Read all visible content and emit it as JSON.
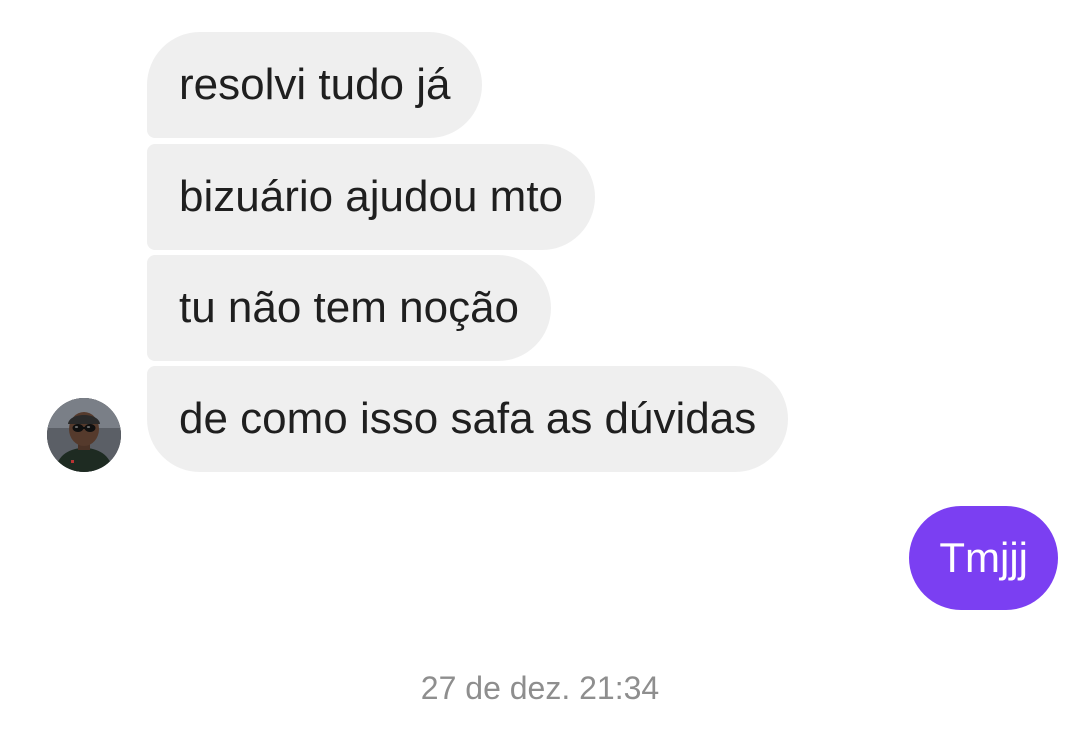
{
  "messages_received": [
    {
      "text": "resolvi tudo já"
    },
    {
      "text": "bizuário ajudou mto"
    },
    {
      "text": "tu não tem noção"
    },
    {
      "text": "de como isso safa as dúvidas"
    }
  ],
  "messages_sent": [
    {
      "text": "Tmjjj"
    }
  ],
  "timestamp": "27 de dez. 21:34",
  "colors": {
    "received_bubble": "#efefef",
    "sent_bubble": "#7b3ff2",
    "timestamp_text": "#8e8e8e"
  },
  "icons": {
    "avatar": "contact-avatar-photo"
  }
}
